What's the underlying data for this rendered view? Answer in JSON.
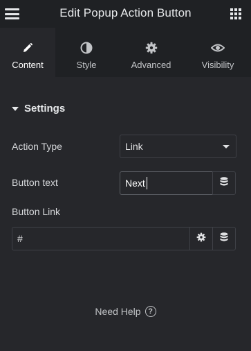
{
  "header": {
    "title": "Edit Popup Action Button",
    "menu_icon": "hamburger-icon",
    "apps_icon": "grid-icon"
  },
  "tabs": [
    {
      "label": "Content",
      "icon": "pencil-icon",
      "active": true
    },
    {
      "label": "Style",
      "icon": "half-circle-icon",
      "active": false
    },
    {
      "label": "Advanced",
      "icon": "gear-icon",
      "active": false
    },
    {
      "label": "Visibility",
      "icon": "eye-icon",
      "active": false
    }
  ],
  "section": {
    "title": "Settings"
  },
  "controls": {
    "action_type": {
      "label": "Action Type",
      "value": "Link"
    },
    "button_text": {
      "label": "Button text",
      "value": "Next"
    },
    "button_link": {
      "label": "Button Link",
      "value": "#"
    }
  },
  "help": {
    "label": "Need Help",
    "icon_glyph": "?"
  },
  "colors": {
    "panel_bg": "#26272b",
    "header_bg": "#1f2124",
    "border": "#3f4147",
    "text": "#e0e1e3"
  }
}
